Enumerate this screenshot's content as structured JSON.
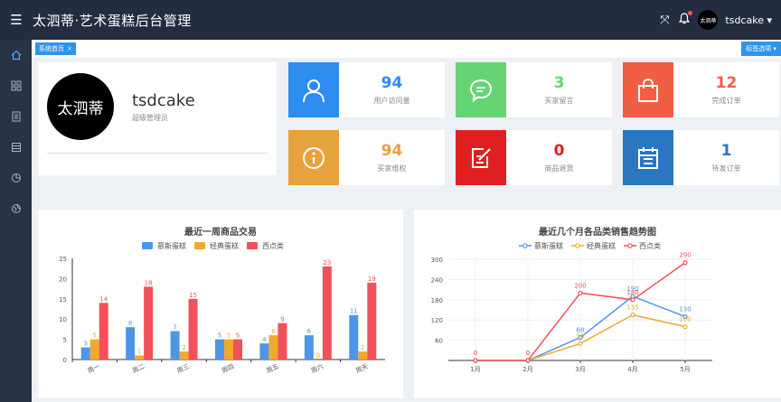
{
  "app": {
    "title": "太泗蒂·艺术蛋糕后台管理"
  },
  "header": {
    "user_name": "tsdcake",
    "user_avatar_text": "太泗蒂",
    "icons": [
      "fullscreen-icon",
      "bell-icon"
    ]
  },
  "tabs": {
    "home_label": "系统首页",
    "options_label": "标签选项"
  },
  "profile": {
    "avatar_text": "太泗蒂",
    "name": "tsdcake",
    "role": "超级管理员"
  },
  "stats": [
    {
      "value": "94",
      "label": "用户访问量",
      "color": "#2d8cf0",
      "icon": "user-icon"
    },
    {
      "value": "3",
      "label": "买家留言",
      "color": "#64d572",
      "icon": "message-icon"
    },
    {
      "value": "12",
      "label": "完成订单",
      "color": "#f25e43",
      "icon": "bag-icon"
    },
    {
      "value": "94",
      "label": "买家维权",
      "color": "#e6a23c",
      "icon": "info-icon"
    },
    {
      "value": "0",
      "label": "商品退货",
      "color": "#e02020",
      "icon": "edit-icon"
    },
    {
      "value": "1",
      "label": "待发订单",
      "color": "#2a76c1",
      "icon": "calendar-icon"
    }
  ],
  "chart_data": [
    {
      "type": "bar",
      "title": "最近一周商品交易",
      "categories": [
        "周一",
        "周二",
        "周三",
        "周四",
        "周五",
        "周六",
        "周天"
      ],
      "series": [
        {
          "name": "慕斯蛋糕",
          "color": "#4f95e6",
          "values": [
            3,
            8,
            7,
            5,
            4,
            6,
            11
          ]
        },
        {
          "name": "经典蛋糕",
          "color": "#f1a92c",
          "values": [
            5,
            1,
            2,
            5,
            6,
            0,
            2
          ]
        },
        {
          "name": "西点类",
          "color": "#f2505a",
          "values": [
            14,
            18,
            15,
            5,
            9,
            23,
            19
          ]
        }
      ],
      "ylim": [
        0,
        25
      ],
      "yticks": [
        0,
        5,
        10,
        15,
        20,
        25
      ],
      "legend": "top-center"
    },
    {
      "type": "line",
      "title": "最近几个月各品类销售趋势图",
      "categories": [
        "1月",
        "2月",
        "3月",
        "4月",
        "5月"
      ],
      "series": [
        {
          "name": "慕斯蛋糕",
          "color": "#4f95e6",
          "values": [
            0,
            0,
            68,
            190,
            130
          ]
        },
        {
          "name": "经典蛋糕",
          "color": "#f1a92c",
          "values": [
            0,
            0,
            50,
            135,
            100
          ]
        },
        {
          "name": "西点类",
          "color": "#f2505a",
          "values": [
            0,
            0,
            200,
            180,
            290
          ]
        }
      ],
      "ylim": [
        0,
        300
      ],
      "yticks": [
        60,
        120,
        180,
        240,
        300
      ],
      "legend": "top-center",
      "grid": true
    }
  ]
}
